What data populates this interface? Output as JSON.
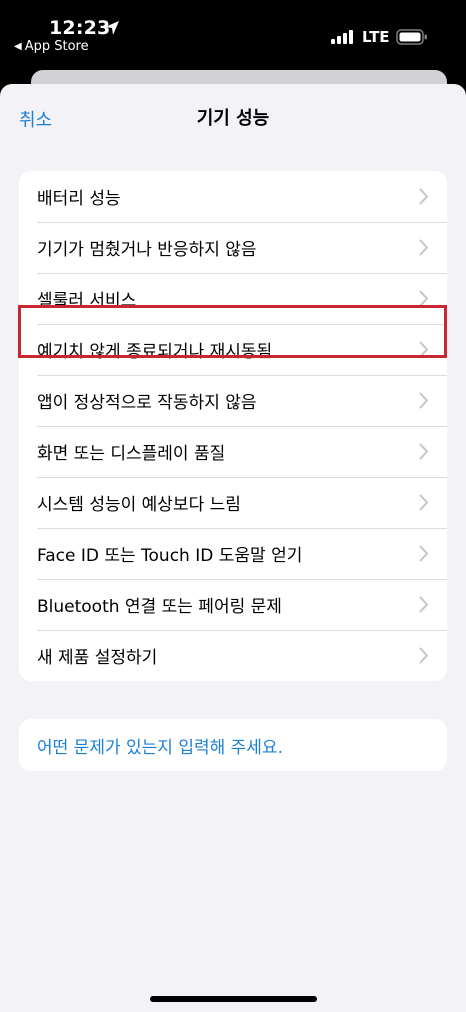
{
  "status_bar": {
    "time": "12:23",
    "back_label": "App Store",
    "network": "LTE"
  },
  "sheet": {
    "cancel_label": "취소",
    "title": "기기 성능"
  },
  "options": [
    {
      "label": "배터리 성능"
    },
    {
      "label": "기기가 멈췄거나 반응하지 않음"
    },
    {
      "label": "셀룰러 서비스"
    },
    {
      "label": "예기치 않게 종료되거나 재시동됨"
    },
    {
      "label": "앱이 정상적으로 작동하지 않음"
    },
    {
      "label": "화면 또는 디스플레이 품질"
    },
    {
      "label": "시스템 성능이 예상보다 느림"
    },
    {
      "label": "Face ID 또는 Touch ID 도움말 얻기"
    },
    {
      "label": "Bluetooth 연결 또는 페어링 문제"
    },
    {
      "label": "새 제품 설정하기"
    }
  ],
  "describe_issue_label": "어떤 문제가 있는지 입력해 주세요.",
  "colors": {
    "accent": "#1c7fd6",
    "highlight": "#c9262f",
    "background": "#f2f2f7"
  }
}
